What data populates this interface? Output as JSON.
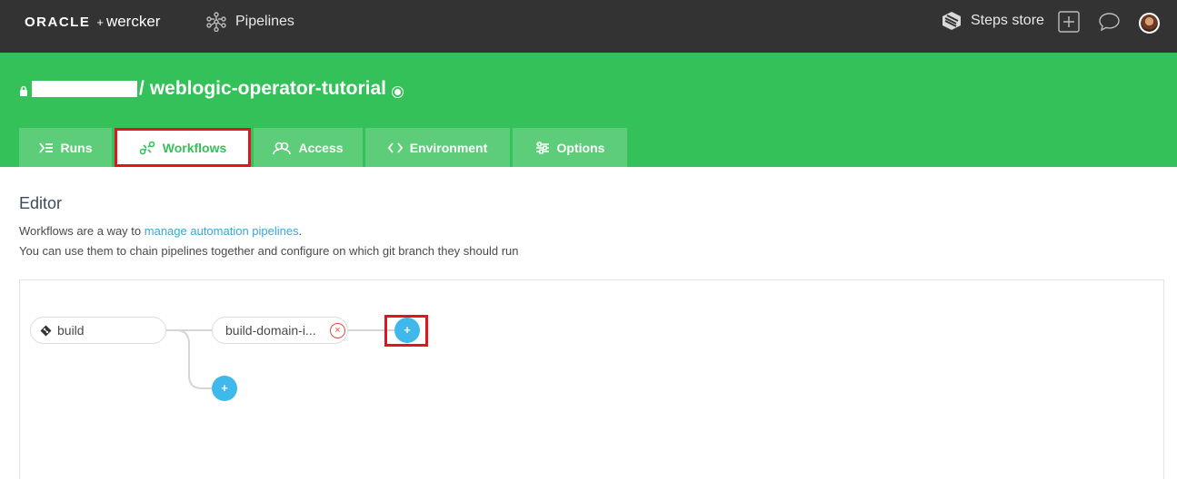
{
  "topbar": {
    "brand_oracle": "ORACLE",
    "brand_plus": "+",
    "brand_wercker": "wercker",
    "pipelines_label": "Pipelines",
    "steps_store_label": "Steps store",
    "icons": [
      "pipelines-icon",
      "steps-store-icon",
      "add-icon",
      "chat-icon",
      "avatar"
    ]
  },
  "header": {
    "repo_separator": "/",
    "repo_name": "weblogic-operator-tutorial",
    "tabs": [
      {
        "label": "Runs",
        "icon": "runs-icon"
      },
      {
        "label": "Workflows",
        "icon": "workflows-icon",
        "active": true
      },
      {
        "label": "Access",
        "icon": "access-icon"
      },
      {
        "label": "Environment",
        "icon": "environment-icon"
      },
      {
        "label": "Options",
        "icon": "options-icon"
      }
    ]
  },
  "editor": {
    "title": "Editor",
    "desc_prefix": "Workflows are a way to ",
    "desc_link": "manage automation pipelines",
    "desc_suffix": ".",
    "desc_line2": "You can use them to chain pipelines together and configure on which git branch they should run",
    "pipeline_nodes": {
      "root": "build",
      "child": "build-domain-i..."
    },
    "remove_label": "×",
    "add_label": "+"
  },
  "colors": {
    "topbar": "#333333",
    "brand_green": "#35c159",
    "link": "#3ba6d8",
    "add_button": "#3fb8ec",
    "highlight": "#e0151f"
  }
}
